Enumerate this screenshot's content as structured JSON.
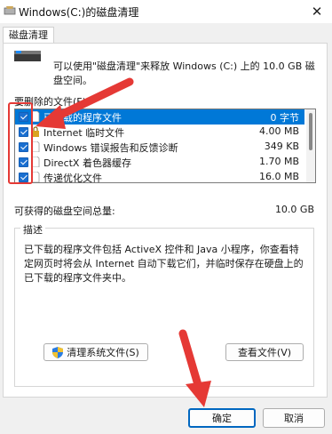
{
  "window": {
    "title": "Windows(C:)的磁盘清理",
    "close_glyph": "✕"
  },
  "tab": {
    "label": "磁盘清理"
  },
  "intro": {
    "text": "可以使用\"磁盘清理\"来释放 Windows (C:) 上的 10.0 GB 磁盘空间。"
  },
  "files_label": "要删除的文件(F):",
  "files": [
    {
      "name": "已下载的程序文件",
      "size": "0 字节",
      "checked": true,
      "selected": true
    },
    {
      "name": "Internet 临时文件",
      "size": "4.00 MB",
      "checked": true,
      "selected": false
    },
    {
      "name": "Windows 错误报告和反馈诊断",
      "size": "349 KB",
      "checked": true,
      "selected": false
    },
    {
      "name": "DirectX 着色器缓存",
      "size": "1.70 MB",
      "checked": true,
      "selected": false
    },
    {
      "name": "传递优化文件",
      "size": "16.0 MB",
      "checked": true,
      "selected": false
    }
  ],
  "total": {
    "label": "可获得的磁盘空间总量:",
    "value": "10.0 GB"
  },
  "description": {
    "title": "描述",
    "text": "已下载的程序文件包括 ActiveX 控件和 Java 小程序，你查看特定网页时将会从 Internet 自动下载它们，并临时保存在硬盘上的已下载的程序文件夹中。"
  },
  "buttons": {
    "clean_system": "清理系统文件(S)",
    "view_files": "查看文件(V)",
    "ok": "确定",
    "cancel": "取消"
  },
  "colors": {
    "accent": "#0078d7",
    "annotation": "#e53935"
  }
}
